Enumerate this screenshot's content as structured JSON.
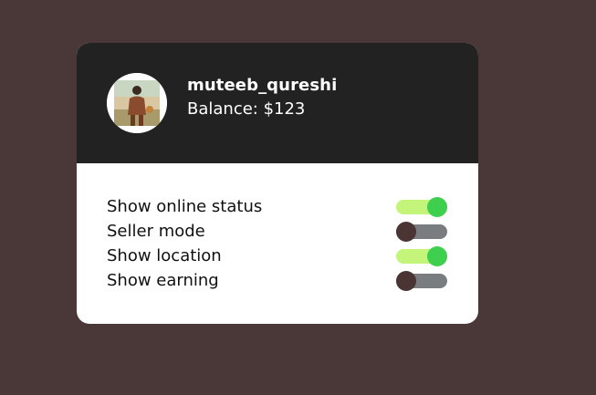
{
  "profile": {
    "username": "muteeb_qureshi",
    "balance": "Balance: $123"
  },
  "settings": [
    {
      "label": "Show online status",
      "enabled": true
    },
    {
      "label": "Seller mode",
      "enabled": false
    },
    {
      "label": "Show location",
      "enabled": true
    },
    {
      "label": "Show earning",
      "enabled": false
    }
  ],
  "colors": {
    "page_background": "#4a3838",
    "header_background": "#222222",
    "toggle_on_track": "#c4f57a",
    "toggle_on_knob": "#3ecf4f",
    "toggle_off_track": "#7a7d80",
    "toggle_off_knob": "#4a3434"
  }
}
